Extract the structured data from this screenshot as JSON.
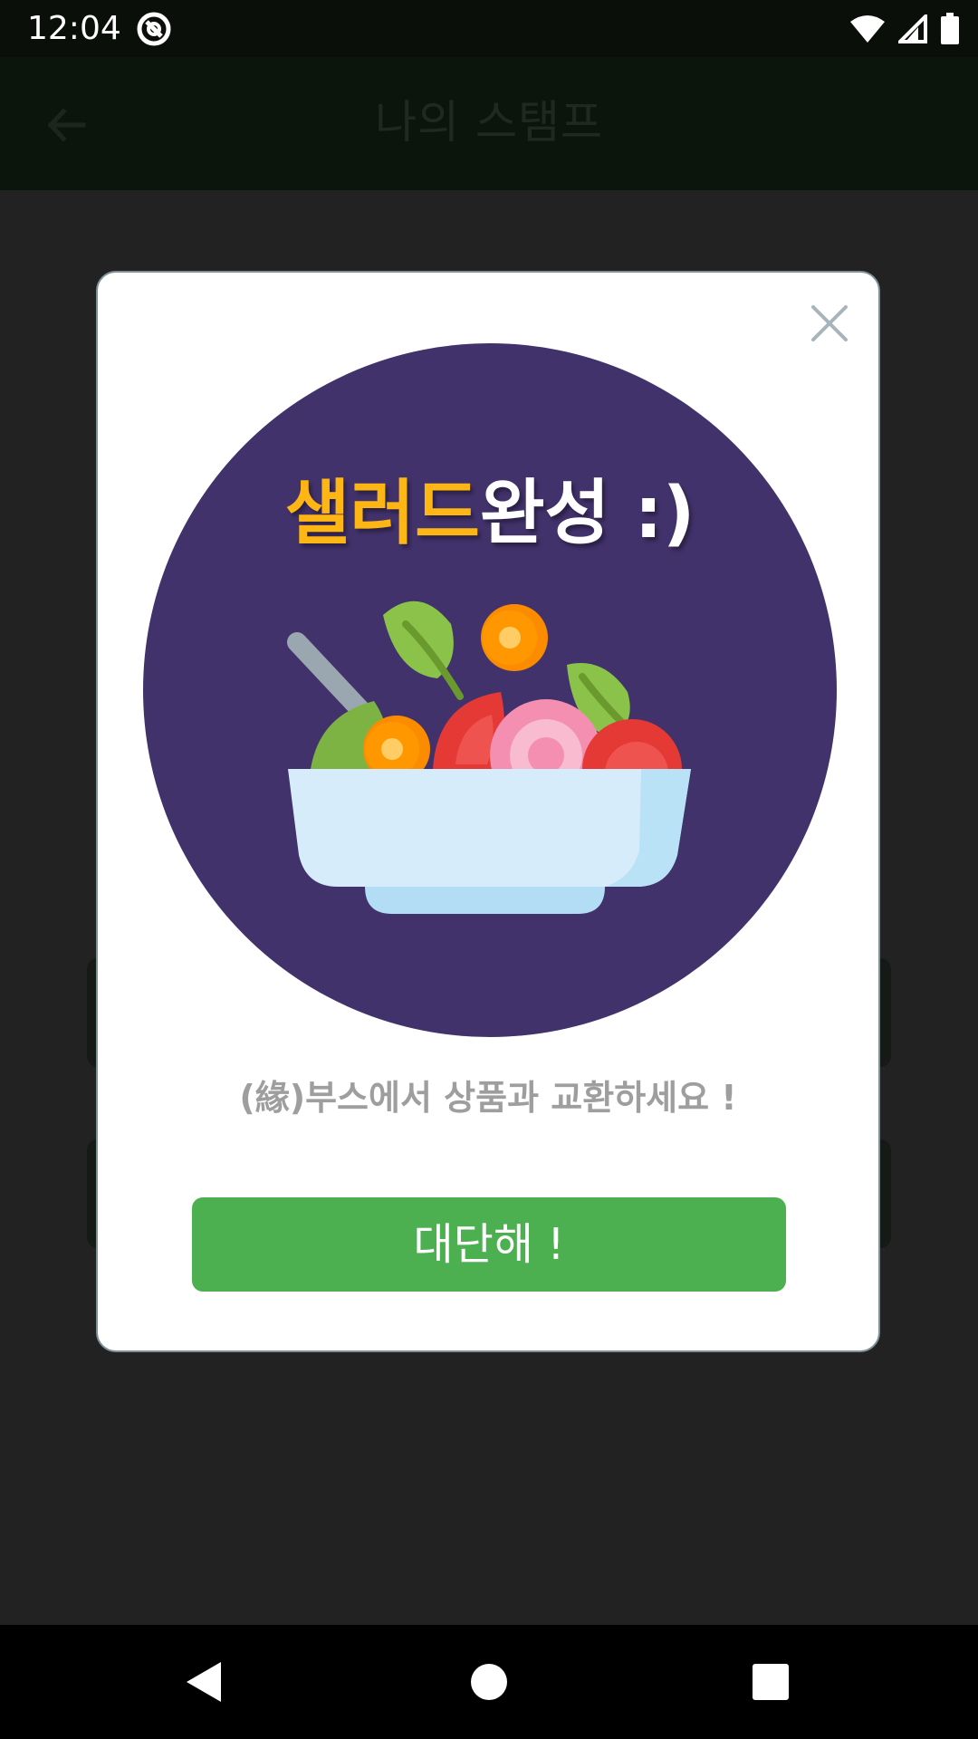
{
  "status_bar": {
    "time": "12:04",
    "icons": [
      "at-sign-icon",
      "wifi-icon",
      "cell-signal-icon",
      "battery-icon"
    ]
  },
  "app_bar": {
    "title": "나의 스탬프",
    "back_icon": "arrow-left-icon"
  },
  "dialog": {
    "close_icon": "close-icon",
    "badge": {
      "title_part1": "샐러드",
      "title_part2": "완성 :)",
      "illustration": "salad-bowl-icon"
    },
    "message": "(緣)부스에서 상품과 교환하세요 !",
    "confirm_label": "대단해 !"
  },
  "nav_bar": {
    "icons": [
      "back-triangle-icon",
      "home-circle-icon",
      "recents-square-icon"
    ]
  },
  "colors": {
    "accent": "#4caf50",
    "badge_bg": "#42326b",
    "title_yellow": "#fdb614",
    "scrim": "#222222"
  }
}
